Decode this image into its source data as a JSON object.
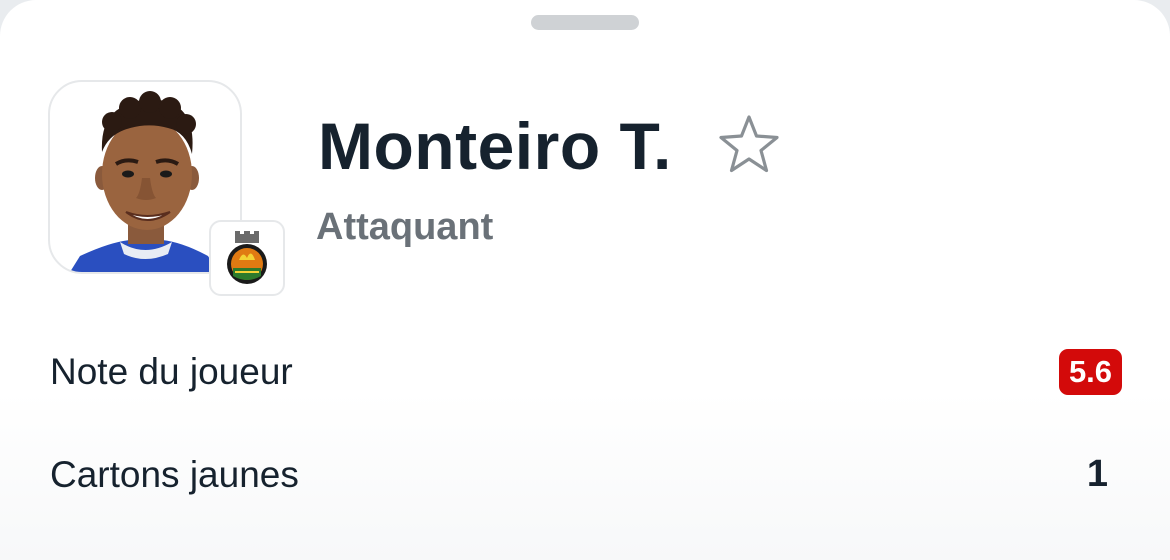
{
  "player": {
    "name": "Monteiro T.",
    "position": "Attaquant",
    "club_badge_icon": "club-crest-icon",
    "favorite_icon": "star-outline-icon"
  },
  "stats": [
    {
      "label": "Note du joueur",
      "value": "5.6",
      "badge_color": "#d30a0a"
    },
    {
      "label": "Cartons jaunes",
      "value": "1"
    }
  ],
  "colors": {
    "text_primary": "#16222e",
    "text_secondary": "#6a7178",
    "rating_bad": "#d30a0a"
  }
}
